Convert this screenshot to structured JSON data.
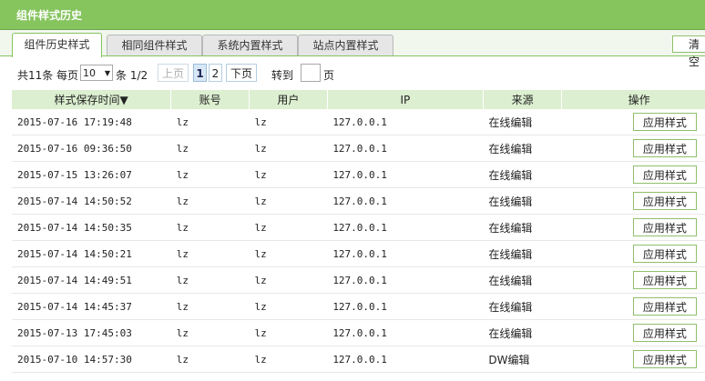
{
  "window": {
    "title": "组件样式历史"
  },
  "tabs": [
    {
      "label": "组件历史样式",
      "active": true
    },
    {
      "label": "相同组件样式",
      "active": false
    },
    {
      "label": "系统内置样式",
      "active": false
    },
    {
      "label": "站点内置样式",
      "active": false
    }
  ],
  "toolbar": {
    "clear_label": "清空"
  },
  "pager": {
    "total_prefix": "共11条",
    "per_page_label": "每页",
    "per_page_value": "10",
    "page_info": "条 1/2",
    "prev_label": "上页",
    "pages": [
      "1",
      "2"
    ],
    "next_label": "下页",
    "goto_label": "转到",
    "page_suffix": "页"
  },
  "table": {
    "headers": [
      "样式保存时间▼",
      "账号",
      "用户",
      "IP",
      "来源",
      "操作"
    ],
    "action_label": "应用样式",
    "rows": [
      {
        "time": "2015-07-16 17:19:48",
        "account": "lz",
        "user": "lz",
        "ip": "127.0.0.1",
        "source": "在线编辑"
      },
      {
        "time": "2015-07-16 09:36:50",
        "account": "lz",
        "user": "lz",
        "ip": "127.0.0.1",
        "source": "在线编辑"
      },
      {
        "time": "2015-07-15 13:26:07",
        "account": "lz",
        "user": "lz",
        "ip": "127.0.0.1",
        "source": "在线编辑"
      },
      {
        "time": "2015-07-14 14:50:52",
        "account": "lz",
        "user": "lz",
        "ip": "127.0.0.1",
        "source": "在线编辑"
      },
      {
        "time": "2015-07-14 14:50:35",
        "account": "lz",
        "user": "lz",
        "ip": "127.0.0.1",
        "source": "在线编辑"
      },
      {
        "time": "2015-07-14 14:50:21",
        "account": "lz",
        "user": "lz",
        "ip": "127.0.0.1",
        "source": "在线编辑"
      },
      {
        "time": "2015-07-14 14:49:51",
        "account": "lz",
        "user": "lz",
        "ip": "127.0.0.1",
        "source": "在线编辑"
      },
      {
        "time": "2015-07-14 14:45:37",
        "account": "lz",
        "user": "lz",
        "ip": "127.0.0.1",
        "source": "在线编辑"
      },
      {
        "time": "2015-07-13 17:45:03",
        "account": "lz",
        "user": "lz",
        "ip": "127.0.0.1",
        "source": "在线编辑"
      },
      {
        "time": "2015-07-10 14:57:30",
        "account": "lz",
        "user": "lz",
        "ip": "127.0.0.1",
        "source": "DW编辑"
      }
    ]
  },
  "colors": {
    "accent": "#86c45e",
    "header_bg": "#dcefd0",
    "button_border": "#8fbf6d"
  }
}
